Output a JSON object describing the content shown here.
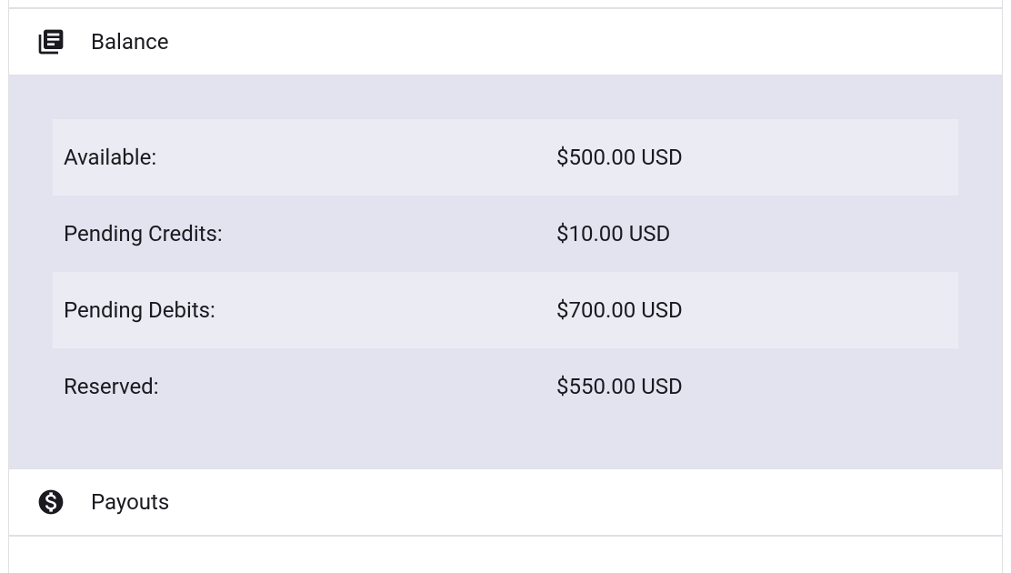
{
  "balance": {
    "title": "Balance",
    "rows": [
      {
        "label": "Available:",
        "value": "$500.00 USD"
      },
      {
        "label": "Pending Credits:",
        "value": "$10.00 USD"
      },
      {
        "label": "Pending Debits:",
        "value": "$700.00 USD"
      },
      {
        "label": "Reserved:",
        "value": "$550.00 USD"
      }
    ]
  },
  "payouts": {
    "title": "Payouts"
  }
}
